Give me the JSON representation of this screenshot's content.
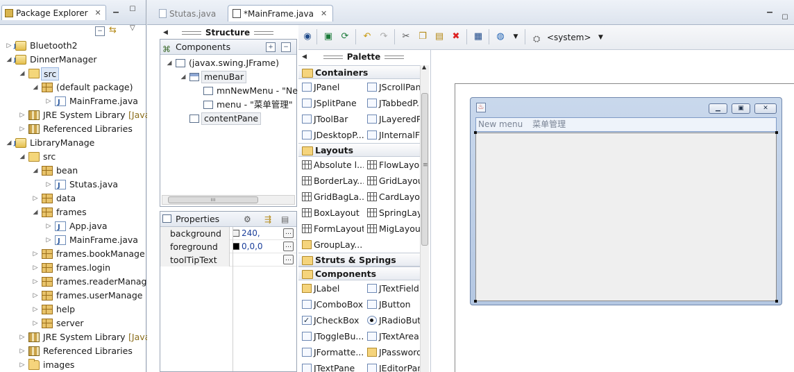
{
  "package_explorer": {
    "tab_label": "Package Explorer",
    "tree": [
      {
        "label": "Bluetooth2",
        "icon": "project-icon",
        "indent": 0,
        "twisty": "▷"
      },
      {
        "label": "DinnerManager",
        "icon": "project-icon",
        "indent": 0,
        "twisty": "◢"
      },
      {
        "label": "src",
        "icon": "source-folder-icon",
        "indent": 1,
        "twisty": "◢",
        "selected": true
      },
      {
        "label": "(default package)",
        "icon": "package-icon",
        "indent": 2,
        "twisty": "◢"
      },
      {
        "label": "MainFrame.java",
        "icon": "java-file-icon",
        "indent": 3,
        "twisty": "▷"
      },
      {
        "label": "JRE System Library",
        "decor": "[Java",
        "icon": "library-icon",
        "indent": 1,
        "twisty": "▷"
      },
      {
        "label": "Referenced Libraries",
        "icon": "library-icon",
        "indent": 1,
        "twisty": "▷"
      },
      {
        "label": "LibraryManage",
        "icon": "project-icon",
        "indent": 0,
        "twisty": "◢"
      },
      {
        "label": "src",
        "icon": "source-folder-icon",
        "indent": 1,
        "twisty": "◢"
      },
      {
        "label": "bean",
        "icon": "package-icon",
        "indent": 2,
        "twisty": "◢"
      },
      {
        "label": "Stutas.java",
        "icon": "java-file-icon",
        "indent": 3,
        "twisty": "▷"
      },
      {
        "label": "data",
        "icon": "package-icon",
        "indent": 2,
        "twisty": "▷"
      },
      {
        "label": "frames",
        "icon": "package-icon",
        "indent": 2,
        "twisty": "◢"
      },
      {
        "label": "App.java",
        "icon": "java-file-icon",
        "indent": 3,
        "twisty": "▷"
      },
      {
        "label": "MainFrame.java",
        "icon": "java-file-icon",
        "indent": 3,
        "twisty": "▷"
      },
      {
        "label": "frames.bookManage",
        "icon": "package-icon",
        "indent": 2,
        "twisty": "▷"
      },
      {
        "label": "frames.login",
        "icon": "package-icon",
        "indent": 2,
        "twisty": "▷"
      },
      {
        "label": "frames.readerManag",
        "icon": "package-icon",
        "indent": 2,
        "twisty": "▷"
      },
      {
        "label": "frames.userManage",
        "icon": "package-icon",
        "indent": 2,
        "twisty": "▷"
      },
      {
        "label": "help",
        "icon": "package-icon",
        "indent": 2,
        "twisty": "▷"
      },
      {
        "label": "server",
        "icon": "package-icon",
        "indent": 2,
        "twisty": "▷"
      },
      {
        "label": "JRE System Library",
        "decor": "[Java",
        "icon": "library-icon",
        "indent": 1,
        "twisty": "▷"
      },
      {
        "label": "Referenced Libraries",
        "icon": "library-icon",
        "indent": 1,
        "twisty": "▷"
      },
      {
        "label": "images",
        "icon": "folder-icon",
        "indent": 1,
        "twisty": "▷"
      }
    ]
  },
  "editor_tabs": [
    {
      "label": "Stutas.java",
      "active": false
    },
    {
      "label": "*MainFrame.java",
      "active": true
    }
  ],
  "structure": {
    "title": "Structure",
    "components_label": "Components",
    "tree": [
      {
        "label": "(javax.swing.JFrame)",
        "indent": 0
      },
      {
        "label": "menuBar",
        "indent": 1
      },
      {
        "label": "mnNewMenu - \"Ne",
        "indent": 2
      },
      {
        "label": "menu - \"菜单管理\"",
        "indent": 2
      },
      {
        "label": "contentPane",
        "indent": 1
      }
    ]
  },
  "properties": {
    "title": "Properties",
    "rows": [
      {
        "name": "background",
        "value": "240,",
        "swatch": "#f0f0f0"
      },
      {
        "name": "foreground",
        "value": "0,0,0",
        "swatch": "#000000"
      },
      {
        "name": "toolTipText",
        "value": "",
        "swatch": ""
      }
    ]
  },
  "toolbar": {
    "system_combo": "<system>"
  },
  "palette": {
    "title": "Palette",
    "categories": [
      {
        "name": "Containers",
        "items": [
          "JPanel",
          "JScrollPane",
          "JSplitPane",
          "JTabbedP...",
          "JToolBar",
          "JLayeredP...",
          "JDesktopP...",
          "JInternalFr..."
        ],
        "icons": [
          "box",
          "box",
          "box",
          "box",
          "box",
          "box",
          "box",
          "box"
        ]
      },
      {
        "name": "Layouts",
        "items": [
          "Absolute l...",
          "FlowLayout",
          "BorderLay...",
          "GridLayout",
          "GridBagLa...",
          "CardLayout",
          "BoxLayout",
          "SpringLay...",
          "FormLayout",
          "MigLayout",
          "GroupLay..."
        ],
        "icons": [
          "lay",
          "lay",
          "lay",
          "lay",
          "lay",
          "lay",
          "lay",
          "lay",
          "lay",
          "lay",
          "lbl"
        ]
      },
      {
        "name": "Struts & Springs",
        "items": [],
        "icons": []
      },
      {
        "name": "Components",
        "items": [
          "JLabel",
          "JTextField",
          "JComboBox",
          "JButton",
          "JCheckBox",
          "JRadioBut...",
          "JToggleBu...",
          "JTextArea",
          "JFormatte...",
          "JPassword...",
          "JTextPane",
          "JEditorPane"
        ],
        "icons": [
          "lbl",
          "box",
          "box",
          "box",
          "chk",
          "rad",
          "box",
          "box",
          "box",
          "lbl",
          "box",
          "box"
        ]
      }
    ]
  },
  "design_frame": {
    "menus": [
      "New menu",
      "菜单管理"
    ]
  },
  "colors": {
    "accent": "#2c5aa0",
    "selection": "#dde8f6",
    "frame_title": "#b4c7e2"
  }
}
